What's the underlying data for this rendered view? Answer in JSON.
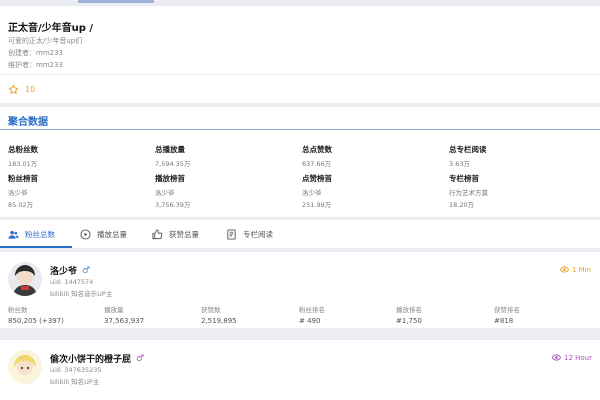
{
  "header": {
    "title": "正太音/少年音up /",
    "subtitle": "可爱的正太/少年音up们",
    "creator": "创建者：mm233",
    "maintainer": "维护者：mm233",
    "star_count": "10"
  },
  "aggregate": {
    "title": "聚合数据",
    "stats": [
      {
        "label": "总粉丝数",
        "value": "183.01万"
      },
      {
        "label": "总播放量",
        "value": "7,594.35万"
      },
      {
        "label": "总点赞数",
        "value": "637.66万"
      },
      {
        "label": "总专栏阅读",
        "value": "3.63万"
      }
    ],
    "tops": [
      {
        "label": "粉丝榜首",
        "name": "洛少爷",
        "value": "85.02万"
      },
      {
        "label": "播放榜首",
        "name": "洛少爷",
        "value": "3,756.39万"
      },
      {
        "label": "点赞榜首",
        "name": "洛少爷",
        "value": "251.99万"
      },
      {
        "label": "专栏榜首",
        "name": "行为艺术方莫",
        "value": "18.20万"
      }
    ]
  },
  "tabs": [
    {
      "label": "粉丝总数",
      "icon": "users-icon",
      "active": true
    },
    {
      "label": "播放总量",
      "icon": "play-icon",
      "active": false
    },
    {
      "label": "获赞总量",
      "icon": "thumbs-up-icon",
      "active": false
    },
    {
      "label": "专栏阅读",
      "icon": "article-icon",
      "active": false
    }
  ],
  "users": [
    {
      "name": "洛少爷",
      "gender": "♂",
      "gender_color": "#3a8de0",
      "uid": "uid: 1447574",
      "desc": "bilibili 知名音乐UP主",
      "time": "1 Min",
      "time_color": "#e8a12c",
      "stats": [
        {
          "label": "粉丝数",
          "value": "850,205 (+397)"
        },
        {
          "label": "播放量",
          "value": "37,563,937"
        },
        {
          "label": "获赞数",
          "value": "2,519,895"
        },
        {
          "label": "粉丝排名",
          "value": "# 490"
        },
        {
          "label": "播放排名",
          "value": "#1,750"
        },
        {
          "label": "获赞排名",
          "value": "#818"
        }
      ]
    },
    {
      "name": "偷次小饼干的橙子屁",
      "gender": "♂",
      "gender_color": "#b04fc4",
      "uid": "uid: 347635235",
      "desc": "bilibili 知名UP主",
      "time": "12 Hour",
      "time_color": "#b04fc4"
    }
  ],
  "colors": {
    "accent": "#2a6fc9",
    "star": "#e8a12c"
  }
}
